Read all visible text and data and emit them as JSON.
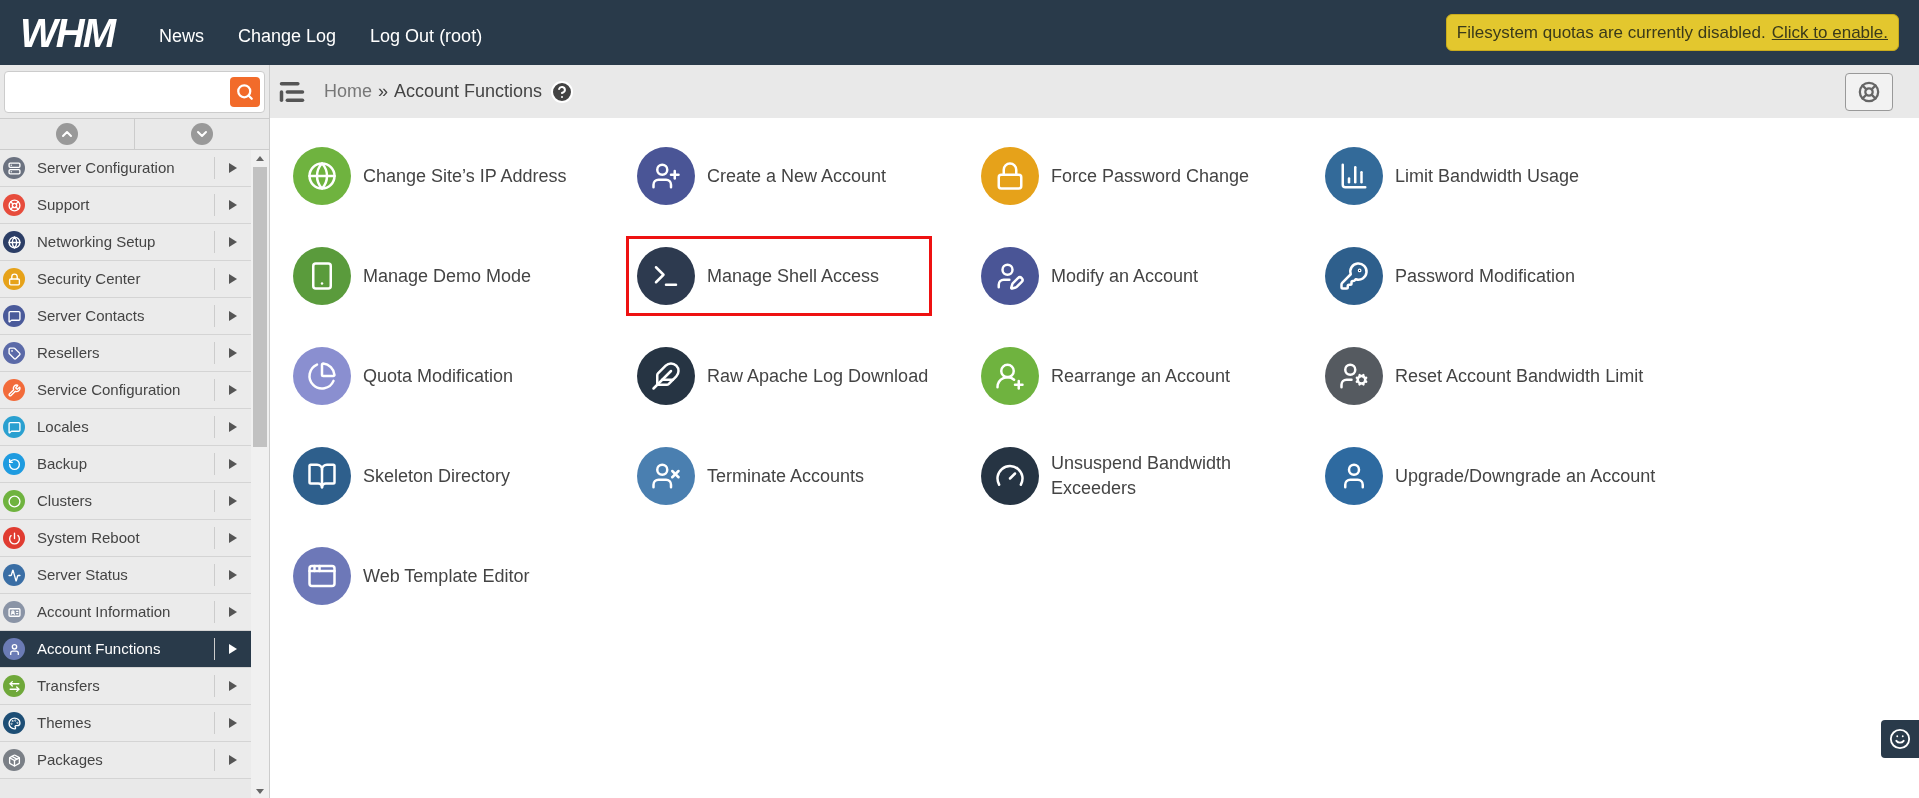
{
  "header": {
    "logo": "WHM",
    "nav": [
      "News",
      "Change Log",
      "Log Out (root)"
    ],
    "notice": {
      "text": "Filesystem quotas are currently disabled.",
      "link": "Click to enable."
    }
  },
  "breadcrumb": {
    "home": "Home",
    "separator": "»",
    "current": "Account Functions"
  },
  "sidebar": {
    "items": [
      {
        "label": "Server Configuration",
        "selected": false
      },
      {
        "label": "Support",
        "selected": false
      },
      {
        "label": "Networking Setup",
        "selected": false
      },
      {
        "label": "Security Center",
        "selected": false
      },
      {
        "label": "Server Contacts",
        "selected": false
      },
      {
        "label": "Resellers",
        "selected": false
      },
      {
        "label": "Service Configuration",
        "selected": false
      },
      {
        "label": "Locales",
        "selected": false
      },
      {
        "label": "Backup",
        "selected": false
      },
      {
        "label": "Clusters",
        "selected": false
      },
      {
        "label": "System Reboot",
        "selected": false
      },
      {
        "label": "Server Status",
        "selected": false
      },
      {
        "label": "Account Information",
        "selected": false
      },
      {
        "label": "Account Functions",
        "selected": true
      },
      {
        "label": "Transfers",
        "selected": false
      },
      {
        "label": "Themes",
        "selected": false
      },
      {
        "label": "Packages",
        "selected": false
      }
    ]
  },
  "functions": [
    {
      "label": "Change Site’s IP Address",
      "highlighted": false
    },
    {
      "label": "Create a New Account",
      "highlighted": false
    },
    {
      "label": "Force Password Change",
      "highlighted": false
    },
    {
      "label": "Limit Bandwidth Usage",
      "highlighted": false
    },
    {
      "label": "Manage Demo Mode",
      "highlighted": false
    },
    {
      "label": "Manage Shell Access",
      "highlighted": true
    },
    {
      "label": "Modify an Account",
      "highlighted": false
    },
    {
      "label": "Password Modification",
      "highlighted": false
    },
    {
      "label": "Quota Modification",
      "highlighted": false
    },
    {
      "label": "Raw Apache Log Download",
      "highlighted": false
    },
    {
      "label": "Rearrange an Account",
      "highlighted": false
    },
    {
      "label": "Reset Account Bandwidth Limit",
      "highlighted": false
    },
    {
      "label": "Skeleton Directory",
      "highlighted": false
    },
    {
      "label": "Terminate Accounts",
      "highlighted": false
    },
    {
      "label": "Unsuspend Bandwidth Exceeders",
      "highlighted": false
    },
    {
      "label": "Upgrade/Downgrade an Account",
      "highlighted": false
    },
    {
      "label": "Web Template Editor",
      "highlighted": false
    }
  ]
}
